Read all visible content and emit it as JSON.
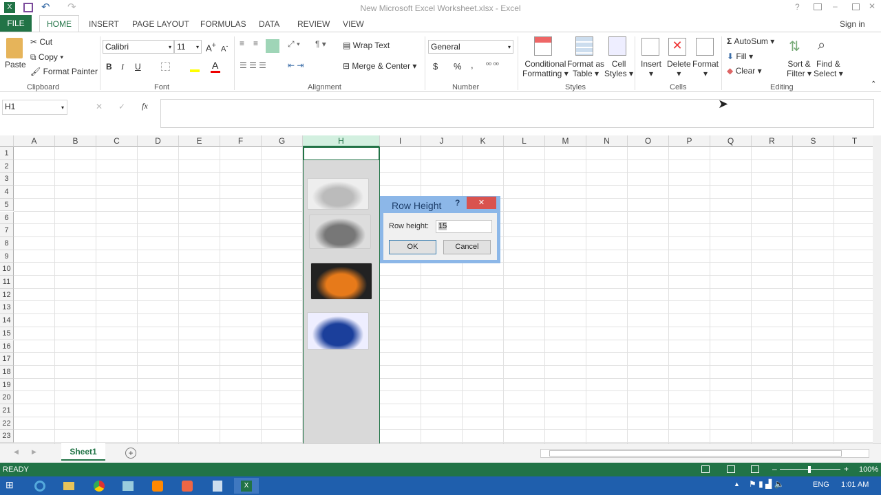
{
  "window": {
    "title": "New Microsoft Excel Worksheet.xlsx - Excel",
    "sign_in": "Sign in"
  },
  "tabs": [
    "FILE",
    "HOME",
    "INSERT",
    "PAGE LAYOUT",
    "FORMULAS",
    "DATA",
    "REVIEW",
    "VIEW"
  ],
  "clipboard": {
    "paste": "Paste",
    "cut": "Cut",
    "copy": "Copy",
    "format_painter": "Format Painter",
    "group": "Clipboard"
  },
  "font": {
    "name": "Calibri",
    "size": "11",
    "bold": "B",
    "italic": "I",
    "underline": "U",
    "group": "Font"
  },
  "alignment": {
    "wrap": "Wrap Text",
    "merge": "Merge & Center",
    "group": "Alignment"
  },
  "number": {
    "format": "General",
    "currency": "$",
    "percent": "%",
    "comma": ",",
    "group": "Number"
  },
  "styles": {
    "cond1": "Conditional",
    "cond2": "Formatting",
    "fmt1": "Format as",
    "fmt2": "Table",
    "cell1": "Cell",
    "cell2": "Styles",
    "group": "Styles"
  },
  "cells": {
    "insert": "Insert",
    "delete": "Delete",
    "format": "Format",
    "group": "Cells"
  },
  "editing": {
    "autosum": "AutoSum",
    "fill": "Fill",
    "clear": "Clear",
    "sort1": "Sort &",
    "sort2": "Filter",
    "find1": "Find &",
    "find2": "Select",
    "group": "Editing"
  },
  "formula_bar": {
    "name_box": "H1",
    "fx": "fx",
    "cancel": "✕",
    "enter": "✓",
    "value": ""
  },
  "columns": [
    "A",
    "B",
    "C",
    "D",
    "E",
    "F",
    "G",
    "H",
    "I",
    "J",
    "K",
    "L",
    "M",
    "N",
    "O",
    "P",
    "Q",
    "R",
    "S",
    "T"
  ],
  "rows": [
    "1",
    "2",
    "3",
    "4",
    "5",
    "6",
    "7",
    "8",
    "9",
    "10",
    "11",
    "12",
    "13",
    "14",
    "15",
    "16",
    "17",
    "18",
    "19",
    "20",
    "21",
    "22",
    "23"
  ],
  "selected_column": "H",
  "dialog": {
    "title": "Row Height",
    "help": "?",
    "close": "✕",
    "label": "Row height:",
    "value": "15",
    "ok": "OK",
    "cancel": "Cancel"
  },
  "sheet_tabs": [
    "Sheet1"
  ],
  "status": {
    "ready": "READY",
    "zoom": "100%"
  },
  "taskbar": {
    "lang": "ENG",
    "time": "1:01 AM"
  },
  "colors": {
    "accent": "#217346",
    "dialog_frame": "#8cb7e8",
    "close": "#d9534f",
    "taskbar": "#1f5fad"
  }
}
